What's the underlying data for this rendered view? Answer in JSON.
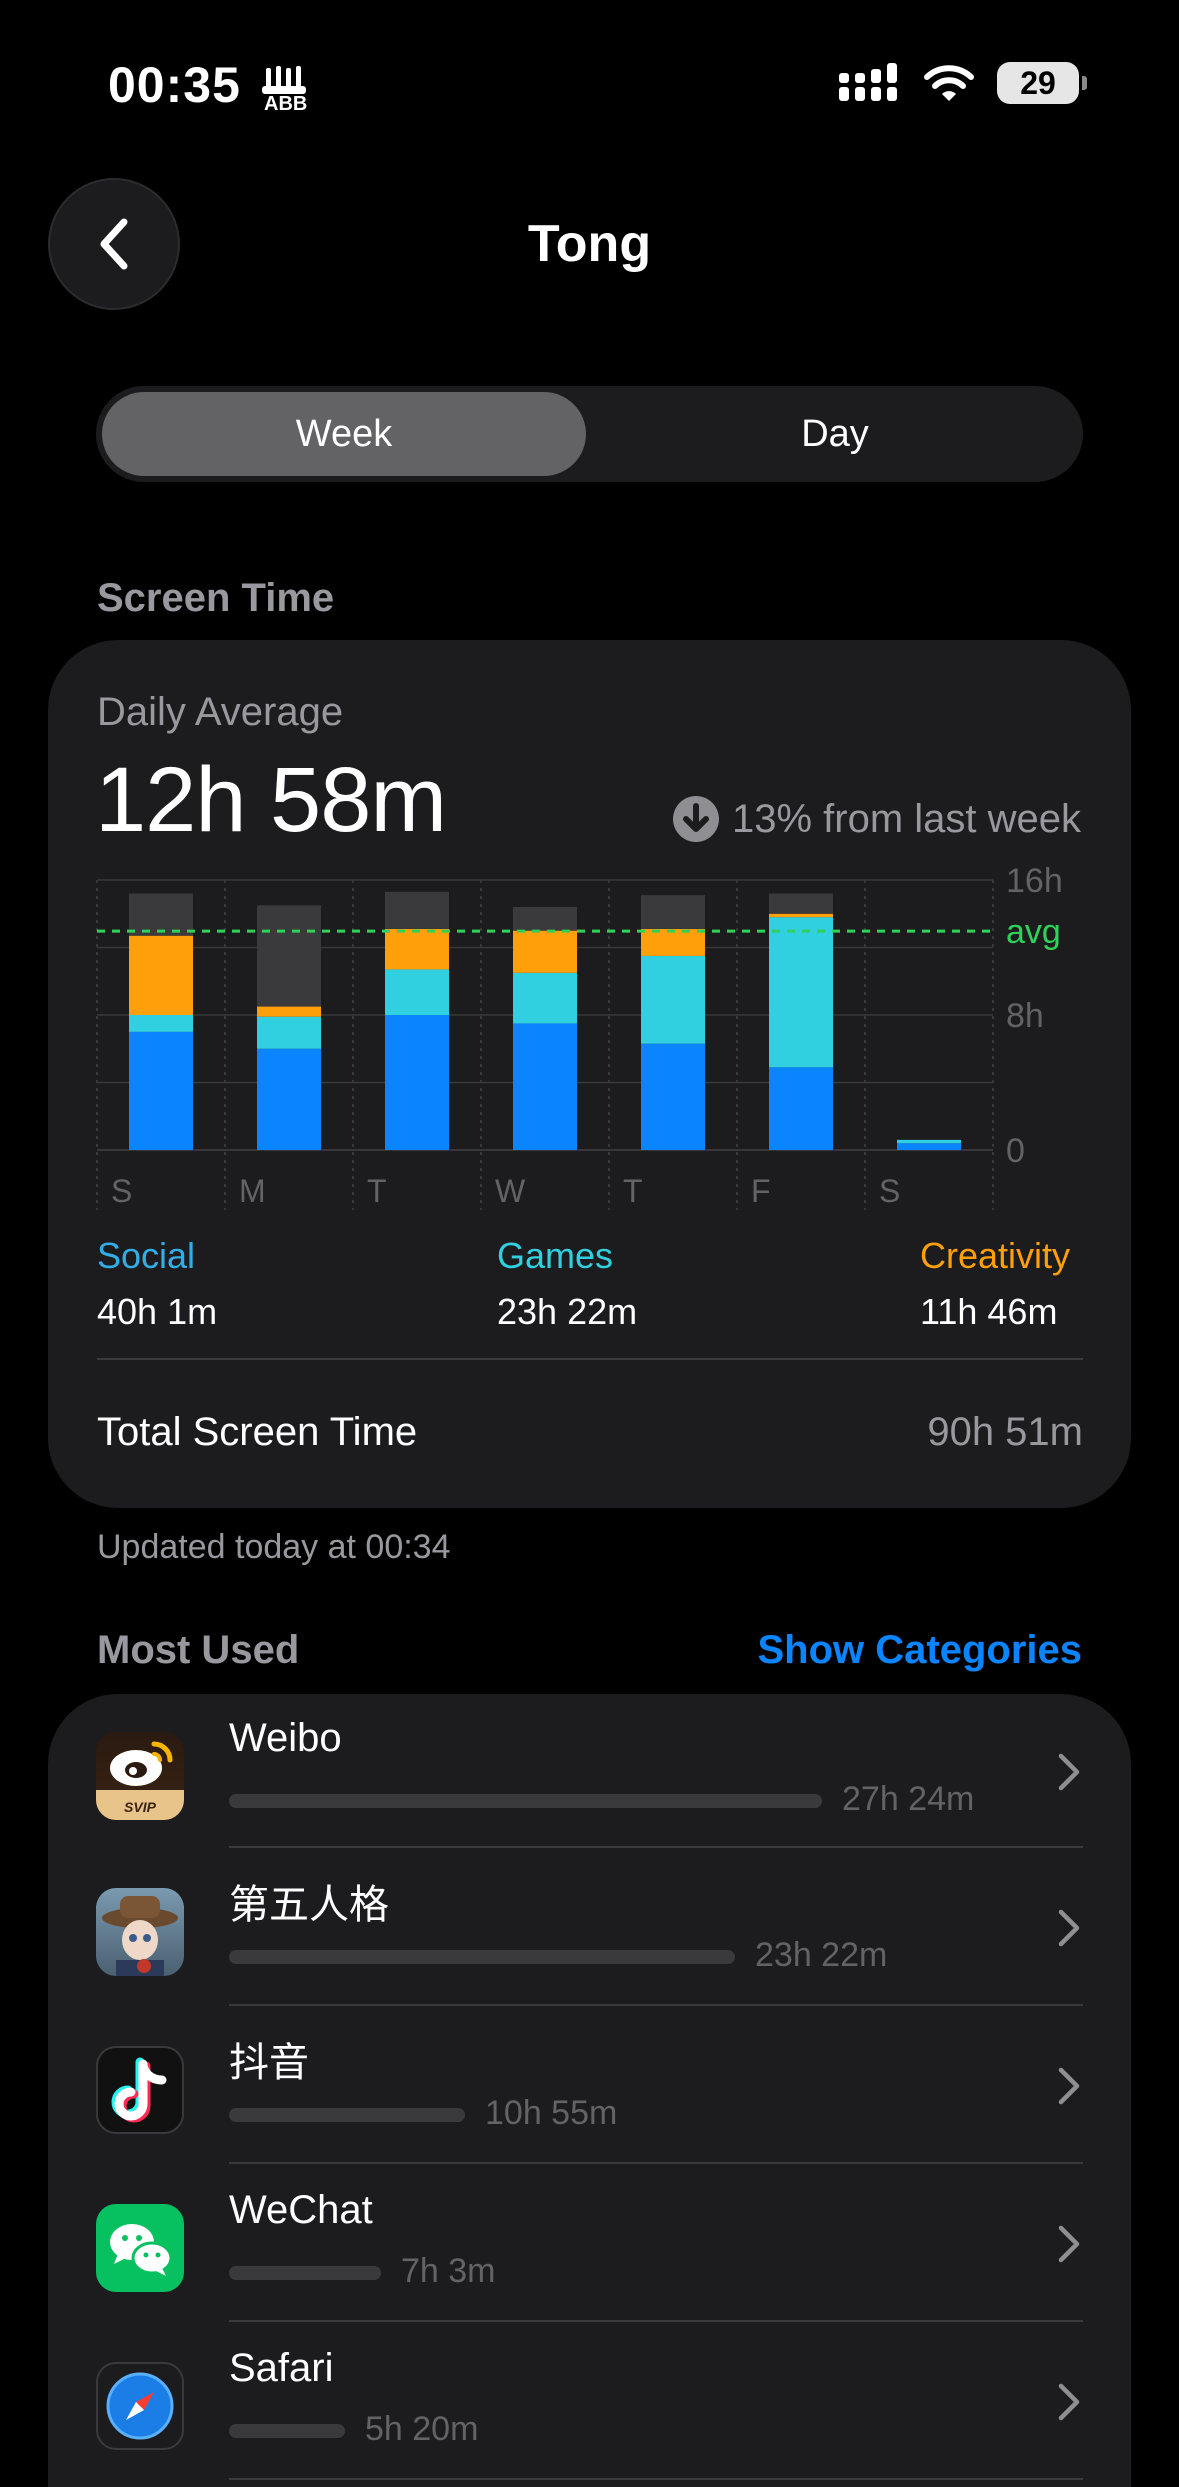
{
  "status_bar": {
    "time": "00:35",
    "battery": "29"
  },
  "nav": {
    "title": "Tong"
  },
  "segments": {
    "week": "Week",
    "day": "Day"
  },
  "screen_time": {
    "section_label": "Screen Time",
    "daily_average_label": "Daily Average",
    "daily_average_value": "12h 58m",
    "trend_text": "13% from last week",
    "total_label": "Total Screen Time",
    "total_value": "90h 51m",
    "updated_text": "Updated today at 00:34"
  },
  "categories": [
    {
      "name": "Social",
      "value": "40h 1m",
      "color": "#0a84ff"
    },
    {
      "name": "Games",
      "value": "23h 22m",
      "color": "#30d0e0"
    },
    {
      "name": "Creativity",
      "value": "11h 46m",
      "color": "#ff9f0a"
    }
  ],
  "colors": {
    "other": "#3a3a3c",
    "avg_line": "#30d158",
    "accent": "#0a84ff"
  },
  "chart_data": {
    "type": "bar",
    "stacked": true,
    "categories": [
      "S",
      "M",
      "T",
      "W",
      "T",
      "F",
      "S"
    ],
    "series": [
      {
        "name": "Social",
        "values": [
          7.0,
          6.0,
          8.0,
          7.5,
          6.3,
          4.9,
          0.4
        ]
      },
      {
        "name": "Games",
        "values": [
          1.0,
          1.9,
          2.7,
          3.0,
          5.2,
          8.9,
          0.2
        ]
      },
      {
        "name": "Creativity",
        "values": [
          4.7,
          0.6,
          2.4,
          2.5,
          1.6,
          0.2,
          0
        ]
      },
      {
        "values": [
          2.5,
          6.0,
          2.2,
          1.4,
          2.0,
          1.2,
          0
        ]
      }
    ],
    "y_ticks": [
      "0",
      "8h",
      "16h"
    ],
    "ylim": [
      0,
      16
    ],
    "avg": 12.97,
    "avg_label": "avg",
    "grid": true
  },
  "most_used": {
    "label": "Most Used",
    "show_categories": "Show Categories",
    "apps": [
      {
        "name": "Weibo",
        "time": "27h 24m",
        "share": 1.0
      },
      {
        "name": "第五人格",
        "time": "23h 22m",
        "share": 0.853
      },
      {
        "name": "抖音",
        "time": "10h 55m",
        "share": 0.398
      },
      {
        "name": "WeChat",
        "time": "7h 3m",
        "share": 0.257
      },
      {
        "name": "Safari",
        "time": "5h 20m",
        "share": 0.195
      }
    ]
  }
}
